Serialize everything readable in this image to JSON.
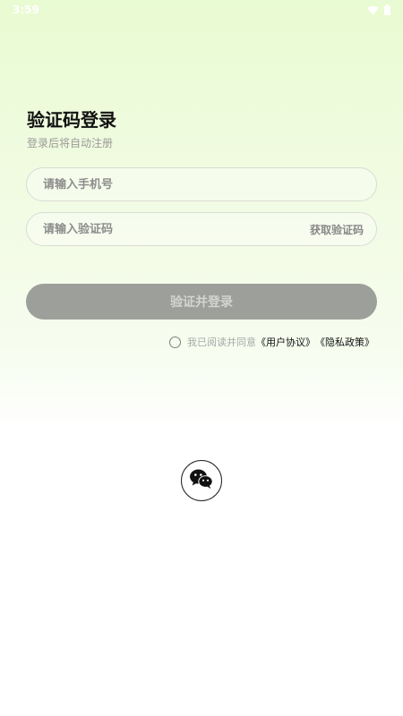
{
  "status_bar": {
    "time": "3:59",
    "icons": [
      "wifi-icon",
      "battery-icon"
    ]
  },
  "login": {
    "title": "验证码登录",
    "subtitle": "登录后将自动注册",
    "phone_placeholder": "请输入手机号",
    "code_placeholder": "请输入验证码",
    "get_code_label": "获取验证码",
    "submit_label": "验证并登录"
  },
  "agreement": {
    "prefix": "我已阅读并同意",
    "user_agreement": "《用户协议》",
    "privacy_policy": "《隐私政策》",
    "checked": false
  },
  "third_party": {
    "wechat_icon": "wechat-icon"
  },
  "colors": {
    "gradient_top": "#e9fbd2",
    "button_bg": "#9c9f9a",
    "button_text": "#d3d5d1"
  }
}
